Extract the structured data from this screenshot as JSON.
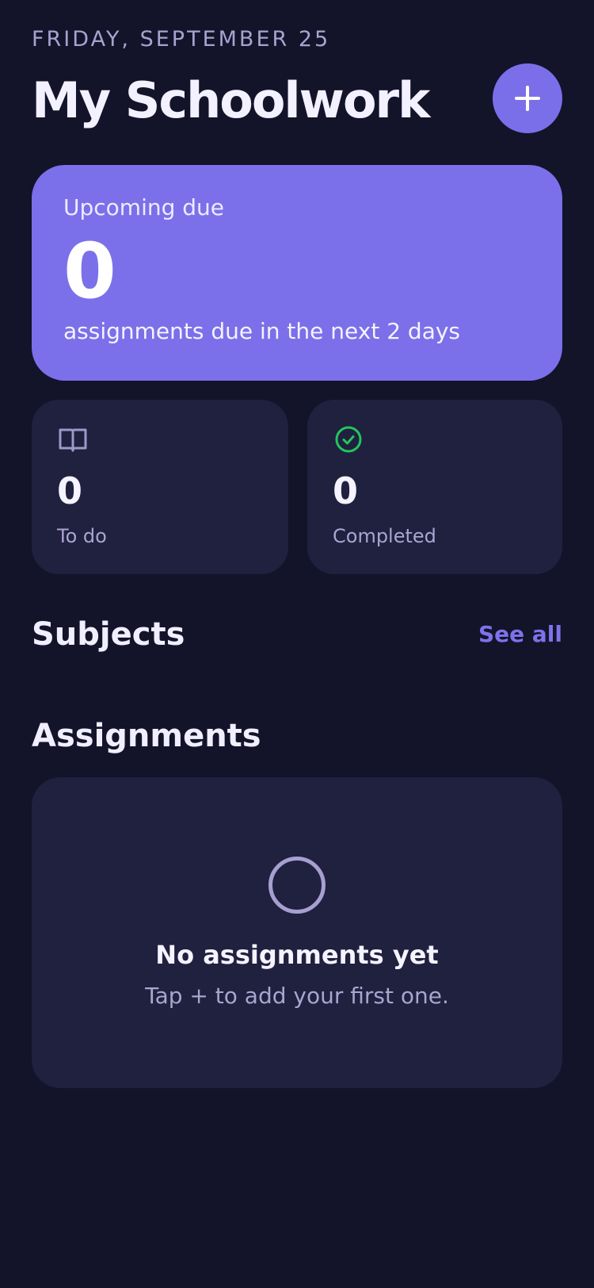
{
  "header": {
    "date": "FRIDAY, SEPTEMBER 25",
    "title": "My Schoolwork",
    "add_icon": "plus-icon"
  },
  "upcoming": {
    "label": "Upcoming due",
    "value": "0",
    "caption": "assignments due in the next 2 days"
  },
  "stats": {
    "todo": {
      "icon": "book-icon",
      "value": "0",
      "label": "To do"
    },
    "completed": {
      "icon": "check-circle-icon",
      "value": "0",
      "label": "Completed"
    }
  },
  "subjects": {
    "title": "Subjects",
    "see_all": "See all"
  },
  "assignments": {
    "title": "Assignments",
    "empty_title": "No assignments yet",
    "empty_subtitle": "Tap + to add your first one."
  },
  "colors": {
    "background": "#13132a",
    "card": "#20203f",
    "accent": "#7b6fe9",
    "success": "#22c55e",
    "muted_text": "#a9a5cf"
  }
}
